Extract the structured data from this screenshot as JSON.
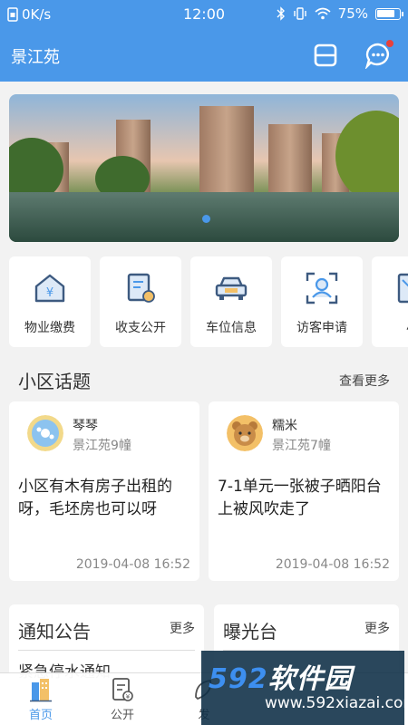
{
  "status": {
    "speed": "0K/s",
    "time": "12:00",
    "battery": "75%"
  },
  "header": {
    "title": "景江苑",
    "scan_icon": "scan-icon",
    "message_icon": "chat-bubble-icon"
  },
  "quick_menu": [
    {
      "label": "物业缴费",
      "icon": "property-fee-icon"
    },
    {
      "label": "收支公开",
      "icon": "finance-report-icon"
    },
    {
      "label": "车位信息",
      "icon": "car-icon"
    },
    {
      "label": "访客申请",
      "icon": "visitor-icon"
    },
    {
      "label": "小",
      "icon": "document-icon"
    }
  ],
  "topics": {
    "title": "小区话题",
    "more": "查看更多",
    "items": [
      {
        "name": "琴琴",
        "sub": "景江苑9幢",
        "body": "小区有木有房子出租的呀，毛坯房也可以呀",
        "time": "2019-04-08 16:52"
      },
      {
        "name": "糯米",
        "sub": "景江苑7幢",
        "body": "7-1单元一张被子晒阳台上被风吹走了",
        "time": "2019-04-08 16:52"
      }
    ]
  },
  "notices": {
    "title": "通知公告",
    "more": "更多",
    "first": "紧急停水通知"
  },
  "exposure": {
    "title": "曝光台",
    "more": "更多"
  },
  "tabs": [
    {
      "label": "首页",
      "icon": "home-building-icon",
      "active": true
    },
    {
      "label": "公开",
      "icon": "public-doc-icon",
      "active": false
    },
    {
      "label": "发",
      "icon": "publish-icon",
      "active": false
    }
  ],
  "watermark": {
    "brand_num": "592",
    "brand_text": "软件园",
    "url": "www.592xiazai.com"
  },
  "colors": {
    "primary": "#4a98e9",
    "badge": "#e8413c"
  }
}
